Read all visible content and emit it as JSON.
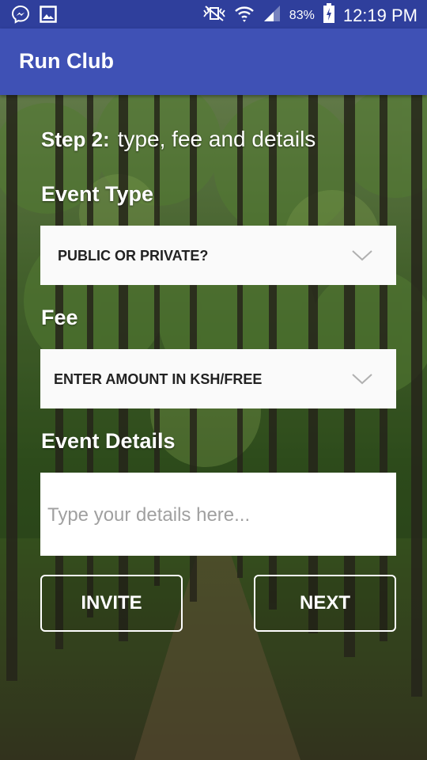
{
  "status_bar": {
    "battery": "83%",
    "time": "12:19 PM"
  },
  "app_bar": {
    "title": "Run Club"
  },
  "form": {
    "step_label": "Step 2:",
    "step_title": "type, fee and details",
    "event_type": {
      "label": "Event Type",
      "selected": "PUBLIC OR PRIVATE?"
    },
    "fee": {
      "label": "Fee",
      "selected": "ENTER AMOUNT IN KSH/FREE"
    },
    "event_details": {
      "label": "Event Details",
      "placeholder": "Type your details here..."
    },
    "invite_label": "INVITE",
    "next_label": "NEXT"
  },
  "colors": {
    "status_bar": "#2f3f9c",
    "app_bar": "#3f51b5",
    "field_background": "#fafafa"
  }
}
